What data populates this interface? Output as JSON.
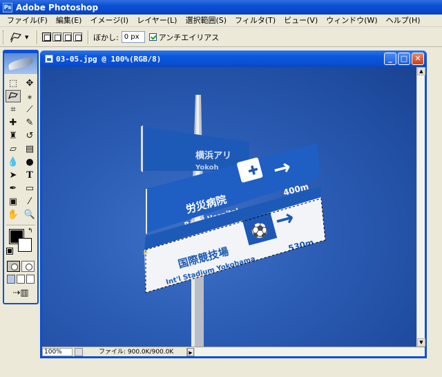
{
  "app": {
    "title": "Adobe Photoshop",
    "icon": "photoshop-icon"
  },
  "menu": {
    "items": [
      "ファイル(F)",
      "編集(E)",
      "イメージ(I)",
      "レイヤー(L)",
      "選択範囲(S)",
      "フィルタ(T)",
      "ビュー(V)",
      "ウィンドウ(W)",
      "ヘルプ(H)"
    ]
  },
  "options": {
    "active_tool_icon": "polygonal-lasso-icon",
    "feather_label": "ぼかし:",
    "feather_value": "0 px",
    "antialias_label": "アンチエイリアス",
    "antialias_checked": true
  },
  "toolbox": {
    "tools": [
      "rectangular-marquee-icon",
      "move-icon",
      "polygonal-lasso-icon",
      "magic-wand-icon",
      "crop-icon",
      "slice-icon",
      "healing-brush-icon",
      "brush-icon",
      "clone-stamp-icon",
      "history-brush-icon",
      "eraser-icon",
      "gradient-icon",
      "blur-icon",
      "dodge-icon",
      "path-selection-icon",
      "type-icon",
      "pen-icon",
      "rectangle-shape-icon",
      "notes-icon",
      "eyedropper-icon",
      "hand-icon",
      "zoom-icon"
    ],
    "foreground_color": "#000000",
    "background_color": "#ffffff"
  },
  "document": {
    "title": "03-05.jpg @ 100%(RGB/8)",
    "zoom": "100%",
    "file_info": "ファイル: 900.0K/900.0K"
  },
  "photo": {
    "sign_top_jp": "横浜アリ",
    "sign_top_en": "Yokoh",
    "sign_middle_jp": "労災病院",
    "sign_middle_en": "Rōsai Hospital",
    "sign_middle_distance": "400m",
    "sign_bottom_jp": "国際競技場",
    "sign_bottom_en": "Int'l Stadium Yokohama",
    "sign_bottom_distance": "530m",
    "sky_color": "#2a5bb3",
    "sign_blue": "#1c58b5"
  }
}
